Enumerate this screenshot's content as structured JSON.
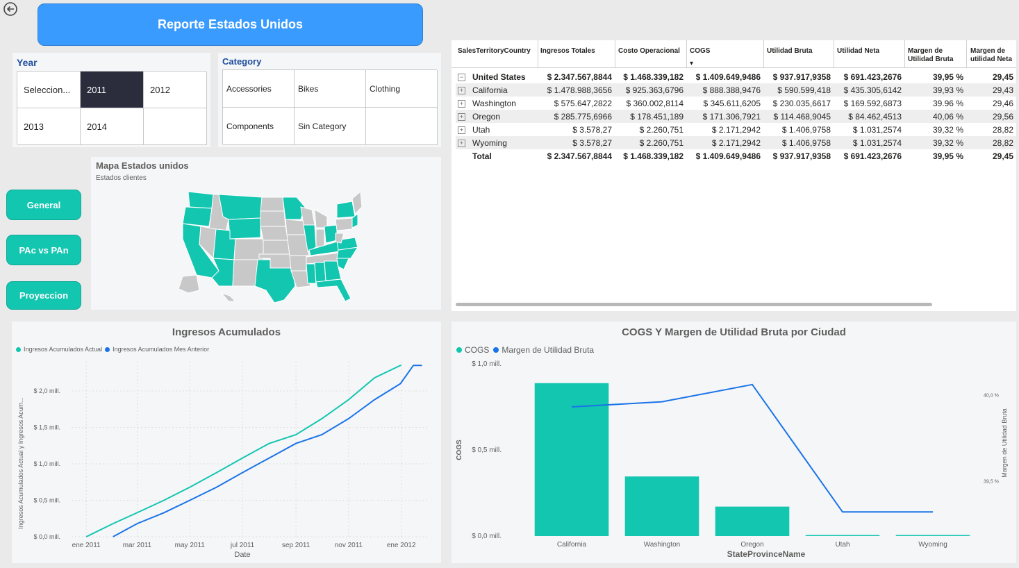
{
  "header": {
    "title": "Reporte Estados Unidos"
  },
  "year_slicer": {
    "title": "Year",
    "options": [
      "Seleccion...",
      "2011",
      "2012",
      "2013",
      "2014"
    ],
    "selected": "2011"
  },
  "category_slicer": {
    "title": "Category",
    "options": [
      "Accessories",
      "Bikes",
      "Clothing",
      "Components",
      "Sin Category"
    ]
  },
  "nav": {
    "general": "General",
    "pac_vs_pan": "PAc vs PAn",
    "proyeccion": "Proyeccion"
  },
  "map": {
    "title": "Mapa Estados unidos",
    "subtitle": "Estados clientes",
    "colors": {
      "active": "#13c6b0",
      "inactive": "#c8c8c8"
    }
  },
  "matrix": {
    "columns": [
      "SalesTerritoryCountry",
      "Ingresos Totales",
      "Costo Operacional",
      "COGS",
      "Utilidad Bruta",
      "Utilidad Neta",
      "Margen de Utilidad Bruta",
      "Margen de utilidad Neta"
    ],
    "sort_glyph": "▾",
    "rows": [
      {
        "label": "United States",
        "expander": "−",
        "values": [
          "$ 2.347.567,8844",
          "$ 1.468.339,182",
          "$ 1.409.649,9486",
          "$ 937.917,9358",
          "$ 691.423,2676",
          "39,95 %",
          "29,45"
        ]
      },
      {
        "label": "California",
        "expander": "+",
        "values": [
          "$ 1.478.988,3656",
          "$ 925.363,6796",
          "$ 888.388,9476",
          "$ 590.599,418",
          "$ 435.305,6142",
          "39,93 %",
          "29,43"
        ]
      },
      {
        "label": "Washington",
        "expander": "+",
        "values": [
          "$ 575.647,2822",
          "$ 360.002,8114",
          "$ 345.611,6205",
          "$ 230.035,6617",
          "$ 169.592,6873",
          "39.96 %",
          "29,46"
        ]
      },
      {
        "label": "Oregon",
        "expander": "+",
        "values": [
          "$ 285.775,6966",
          "$ 178.451,189",
          "$ 171.306,7921",
          "$ 114.468,9045",
          "$ 84.462,4513",
          "40,06 %",
          "29,56"
        ]
      },
      {
        "label": "Utah",
        "expander": "+",
        "values": [
          "$ 3.578,27",
          "$ 2.260,751",
          "$ 2.171,2942",
          "$ 1.406,9758",
          "$ 1.031,2574",
          "39,32 %",
          "28,82"
        ]
      },
      {
        "label": "Wyoming",
        "expander": "+",
        "values": [
          "$ 3.578,27",
          "$ 2.260,751",
          "$ 2.171,2942",
          "$ 1.406,9758",
          "$ 1.031,2574",
          "39,32 %",
          "28,82"
        ]
      }
    ],
    "total": {
      "label": "Total",
      "values": [
        "$ 2.347.567,8844",
        "$ 1.468.339,182",
        "$ 1.409.649,9486",
        "$ 937.917,9358",
        "$ 691.423,2676",
        "39,95 %",
        "29,45"
      ]
    }
  },
  "chart_data": [
    {
      "type": "line",
      "title": "Ingresos Acumulados",
      "xlabel": "Date",
      "ylabel": "Ingresos Acumulados Actual y Ingresos Acum...",
      "x_ticks": [
        "ene 2011",
        "mar 2011",
        "may 2011",
        "jul 2011",
        "sep 2011",
        "nov 2011",
        "ene 2012"
      ],
      "y_ticks": [
        "$ 0,0 mill.",
        "$ 0,5 mill.",
        "$ 1,0 mill.",
        "$ 1,5 mill.",
        "$ 2,0 mill."
      ],
      "ylim": [
        0,
        2.4
      ],
      "xlim": [
        "2010-12-15",
        "2012-01-31"
      ],
      "grid": true,
      "legend_position": "top-left",
      "series": [
        {
          "name": "Ingresos Acumulados Actual",
          "color": "#13c6b0",
          "points": [
            [
              "2011-01-01",
              0.0
            ],
            [
              "2011-02-01",
              0.18
            ],
            [
              "2011-03-01",
              0.33
            ],
            [
              "2011-04-01",
              0.5
            ],
            [
              "2011-05-01",
              0.68
            ],
            [
              "2011-06-01",
              0.88
            ],
            [
              "2011-07-01",
              1.08
            ],
            [
              "2011-08-01",
              1.28
            ],
            [
              "2011-09-01",
              1.4
            ],
            [
              "2011-10-01",
              1.62
            ],
            [
              "2011-11-01",
              1.88
            ],
            [
              "2011-12-01",
              2.18
            ],
            [
              "2011-12-31",
              2.35
            ],
            [
              "2012-01-01",
              2.35
            ]
          ]
        },
        {
          "name": "Ingresos Acumulados Mes Anterior",
          "color": "#1a73e8",
          "points": [
            [
              "2011-02-01",
              0.0
            ],
            [
              "2011-03-01",
              0.18
            ],
            [
              "2011-04-01",
              0.33
            ],
            [
              "2011-05-01",
              0.5
            ],
            [
              "2011-06-01",
              0.68
            ],
            [
              "2011-07-01",
              0.88
            ],
            [
              "2011-08-01",
              1.08
            ],
            [
              "2011-09-01",
              1.28
            ],
            [
              "2011-10-01",
              1.4
            ],
            [
              "2011-11-01",
              1.62
            ],
            [
              "2011-12-01",
              1.88
            ],
            [
              "2011-12-31",
              2.1
            ],
            [
              "2012-01-15",
              2.35
            ],
            [
              "2012-01-25",
              2.35
            ]
          ]
        }
      ]
    },
    {
      "type": "bar",
      "title": "COGS Y Margen de Utilidad Bruta por Ciudad",
      "xlabel": "StateProvinceName",
      "ylabel": "COGS",
      "y2label": "Margen de Utilidad Bruta",
      "categories": [
        "California",
        "Washington",
        "Oregon",
        "Utah",
        "Wyoming"
      ],
      "y_ticks": [
        "$ 0,0 mill.",
        "$ 0,5 mill.",
        "$ 1,0 mill."
      ],
      "y2_ticks": [
        "39,5 %",
        "40,0 %"
      ],
      "ylim": [
        0,
        1.0
      ],
      "y2lim": [
        39.18,
        40.18
      ],
      "legend_position": "top-left",
      "series": [
        {
          "name": "COGS",
          "type": "bar",
          "color": "#13c6b0",
          "values": [
            0.888,
            0.346,
            0.171,
            0.002,
            0.002
          ]
        },
        {
          "name": "Margen de Utilidad Bruta",
          "type": "line",
          "color": "#1a73e8",
          "values": [
            39.93,
            39.96,
            40.06,
            39.32,
            39.32
          ]
        }
      ]
    }
  ]
}
